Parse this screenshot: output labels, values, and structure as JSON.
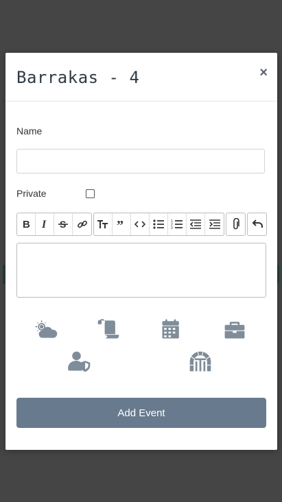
{
  "modal": {
    "title": "Barrakas - 4",
    "close_label": "×",
    "name_label": "Name",
    "name_value": "",
    "private_label": "Private",
    "private_checked": false,
    "editor_value": "",
    "add_button_label": "Add Event"
  },
  "toolbar": {
    "groups": [
      [
        "bold-icon",
        "italic-icon",
        "strikethrough-icon",
        "link-icon"
      ],
      [
        "heading-icon",
        "quote-icon",
        "code-icon",
        "bulleted-list-icon",
        "numbered-list-icon",
        "outdent-icon",
        "indent-icon"
      ],
      [
        "attachment-icon"
      ],
      [
        "undo-icon"
      ]
    ]
  },
  "event_types": [
    "weather-icon",
    "scroll-icon",
    "calendar-icon",
    "briefcase-icon",
    "user-shield-icon",
    "dungeon-icon"
  ],
  "colors": {
    "icon_gray": "#7f8c99",
    "button_bg": "#687a8d",
    "title_color": "#2f3a45"
  }
}
